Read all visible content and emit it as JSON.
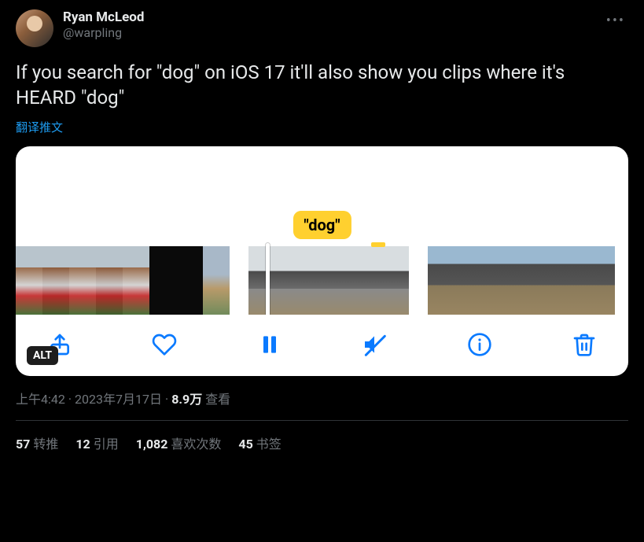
{
  "author": {
    "display_name": "Ryan McLeod",
    "handle": "@warpling"
  },
  "tweet_text": "If you search for \"dog\" on iOS 17 it'll also show you clips where it's HEARD \"dog\"",
  "translate_label": "翻译推文",
  "media": {
    "dog_label": "\"dog\"",
    "alt_badge": "ALT"
  },
  "meta": {
    "time": "上午4:42",
    "date": "2023年7月17日",
    "views_num": "8.9万",
    "views_label": "查看"
  },
  "stats": {
    "retweets": {
      "num": "57",
      "label": "转推"
    },
    "quotes": {
      "num": "12",
      "label": "引用"
    },
    "likes": {
      "num": "1,082",
      "label": "喜欢次数"
    },
    "bookmarks": {
      "num": "45",
      "label": "书签"
    }
  }
}
